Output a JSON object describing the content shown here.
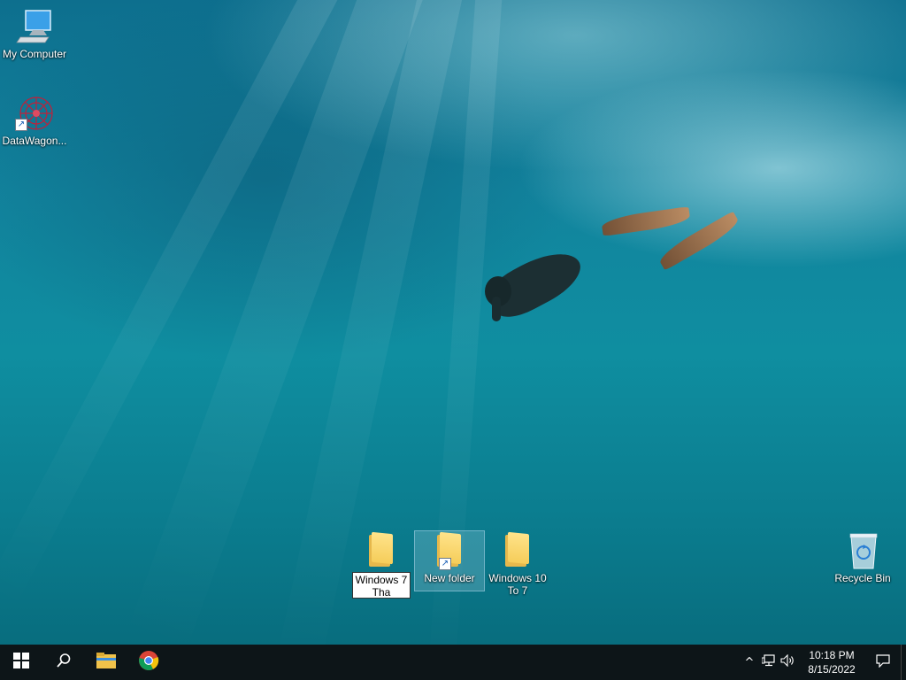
{
  "desktop_icons": {
    "my_computer": {
      "label": "My Computer",
      "icon": "monitor-icon"
    },
    "datawagon": {
      "label": "DataWagon...",
      "icon": "datawagon-app-icon"
    },
    "windows7": {
      "label": "Windows 7",
      "rename_value": "Windows 7 Tha",
      "icon": "folder-icon"
    },
    "new_folder": {
      "label": "New folder",
      "icon": "folder-shortcut-icon"
    },
    "windows10": {
      "label": "Windows 10 To 7",
      "icon": "folder-icon"
    },
    "recycle_bin": {
      "label": "Recycle Bin",
      "icon": "recycle-bin-icon"
    }
  },
  "taskbar": {
    "start": {
      "icon": "windows-start-icon"
    },
    "search": {
      "icon": "search-icon"
    },
    "pinned": [
      {
        "name": "File Explorer",
        "icon": "file-explorer-icon"
      },
      {
        "name": "Google Chrome",
        "icon": "chrome-icon"
      }
    ],
    "tray": {
      "chevron": "^",
      "network_icon": "network-icon",
      "volume_icon": "volume-icon",
      "time": "10:18 PM",
      "date": "8/15/2022",
      "notification_icon": "notification-icon"
    }
  },
  "colors": {
    "taskbar": "#0d1518",
    "folder": "#f5cd5a",
    "water": "#12849e"
  }
}
